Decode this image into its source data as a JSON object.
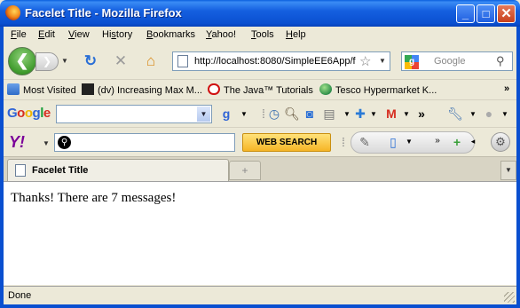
{
  "window": {
    "title": "Facelet Title - Mozilla Firefox",
    "controls": {
      "minimize": "_",
      "maximize": "□",
      "close": "✕"
    }
  },
  "menu": [
    {
      "label": "File",
      "accel": "F",
      "rest": "ile"
    },
    {
      "label": "Edit",
      "accel": "E",
      "rest": "dit"
    },
    {
      "label": "View",
      "accel": "V",
      "rest": "iew"
    },
    {
      "label": "History",
      "accel": "",
      "rest": "Hi",
      "accel2": "s",
      "rest2": "tory"
    },
    {
      "label": "Bookmarks",
      "accel": "B",
      "rest": "ookmarks"
    },
    {
      "label": "Yahoo!",
      "accel": "Y",
      "rest": "ahoo!"
    },
    {
      "label": "Tools",
      "accel": "T",
      "rest": "ools"
    },
    {
      "label": "Help",
      "accel": "H",
      "rest": "elp"
    }
  ],
  "navigation": {
    "url": "http://localhost:8080/SimpleEE6App/f",
    "search_placeholder": "Google"
  },
  "bookmarks": [
    {
      "label": "Most Visited",
      "icon": "bookmark-folder-icon"
    },
    {
      "label": "(dv) Increasing Max M...",
      "icon": "mt-icon"
    },
    {
      "label": "The Java™ Tutorials",
      "icon": "oracle-icon"
    },
    {
      "label": "Tesco Hypermarket K...",
      "icon": "globe-icon"
    }
  ],
  "google_toolbar": {
    "logo": "Google"
  },
  "yahoo_toolbar": {
    "logo": "Y!",
    "search_button": "WEB SEARCH"
  },
  "tab": {
    "title": "Facelet Title"
  },
  "content": {
    "message": "Thanks! There are 7 messages!"
  },
  "status": {
    "text": "Done"
  },
  "colors": {
    "titlebar": "#0a4fd0",
    "chrome": "#ece9d8",
    "yahoo": "#7b0099",
    "web_search": "#f6b526"
  }
}
